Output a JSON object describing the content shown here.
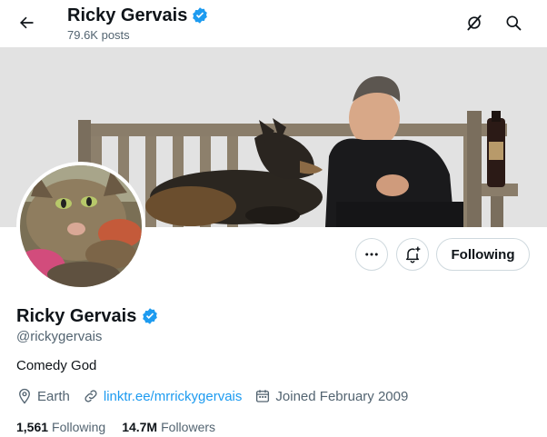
{
  "header": {
    "name": "Ricky Gervais",
    "posts": "79.6K posts"
  },
  "profile": {
    "name": "Ricky Gervais",
    "handle": "@rickygervais",
    "bio": "Comedy God",
    "location": "Earth",
    "link": "linktr.ee/mrrickygervais",
    "joined": "Joined February 2009",
    "following_count": "1,561",
    "following_label": "Following",
    "followers_count": "14.7M",
    "followers_label": "Followers",
    "verified": true
  },
  "actions": {
    "follow_button": "Following"
  },
  "colors": {
    "accent": "#1d9bf0",
    "text_primary": "#0f1419",
    "text_secondary": "#536471",
    "border": "#cfd9de"
  },
  "icons": [
    "back-arrow-icon",
    "verified-badge-icon",
    "grok-icon",
    "search-icon",
    "more-icon",
    "notification-bell-add-icon",
    "location-pin-icon",
    "link-icon",
    "calendar-icon"
  ]
}
